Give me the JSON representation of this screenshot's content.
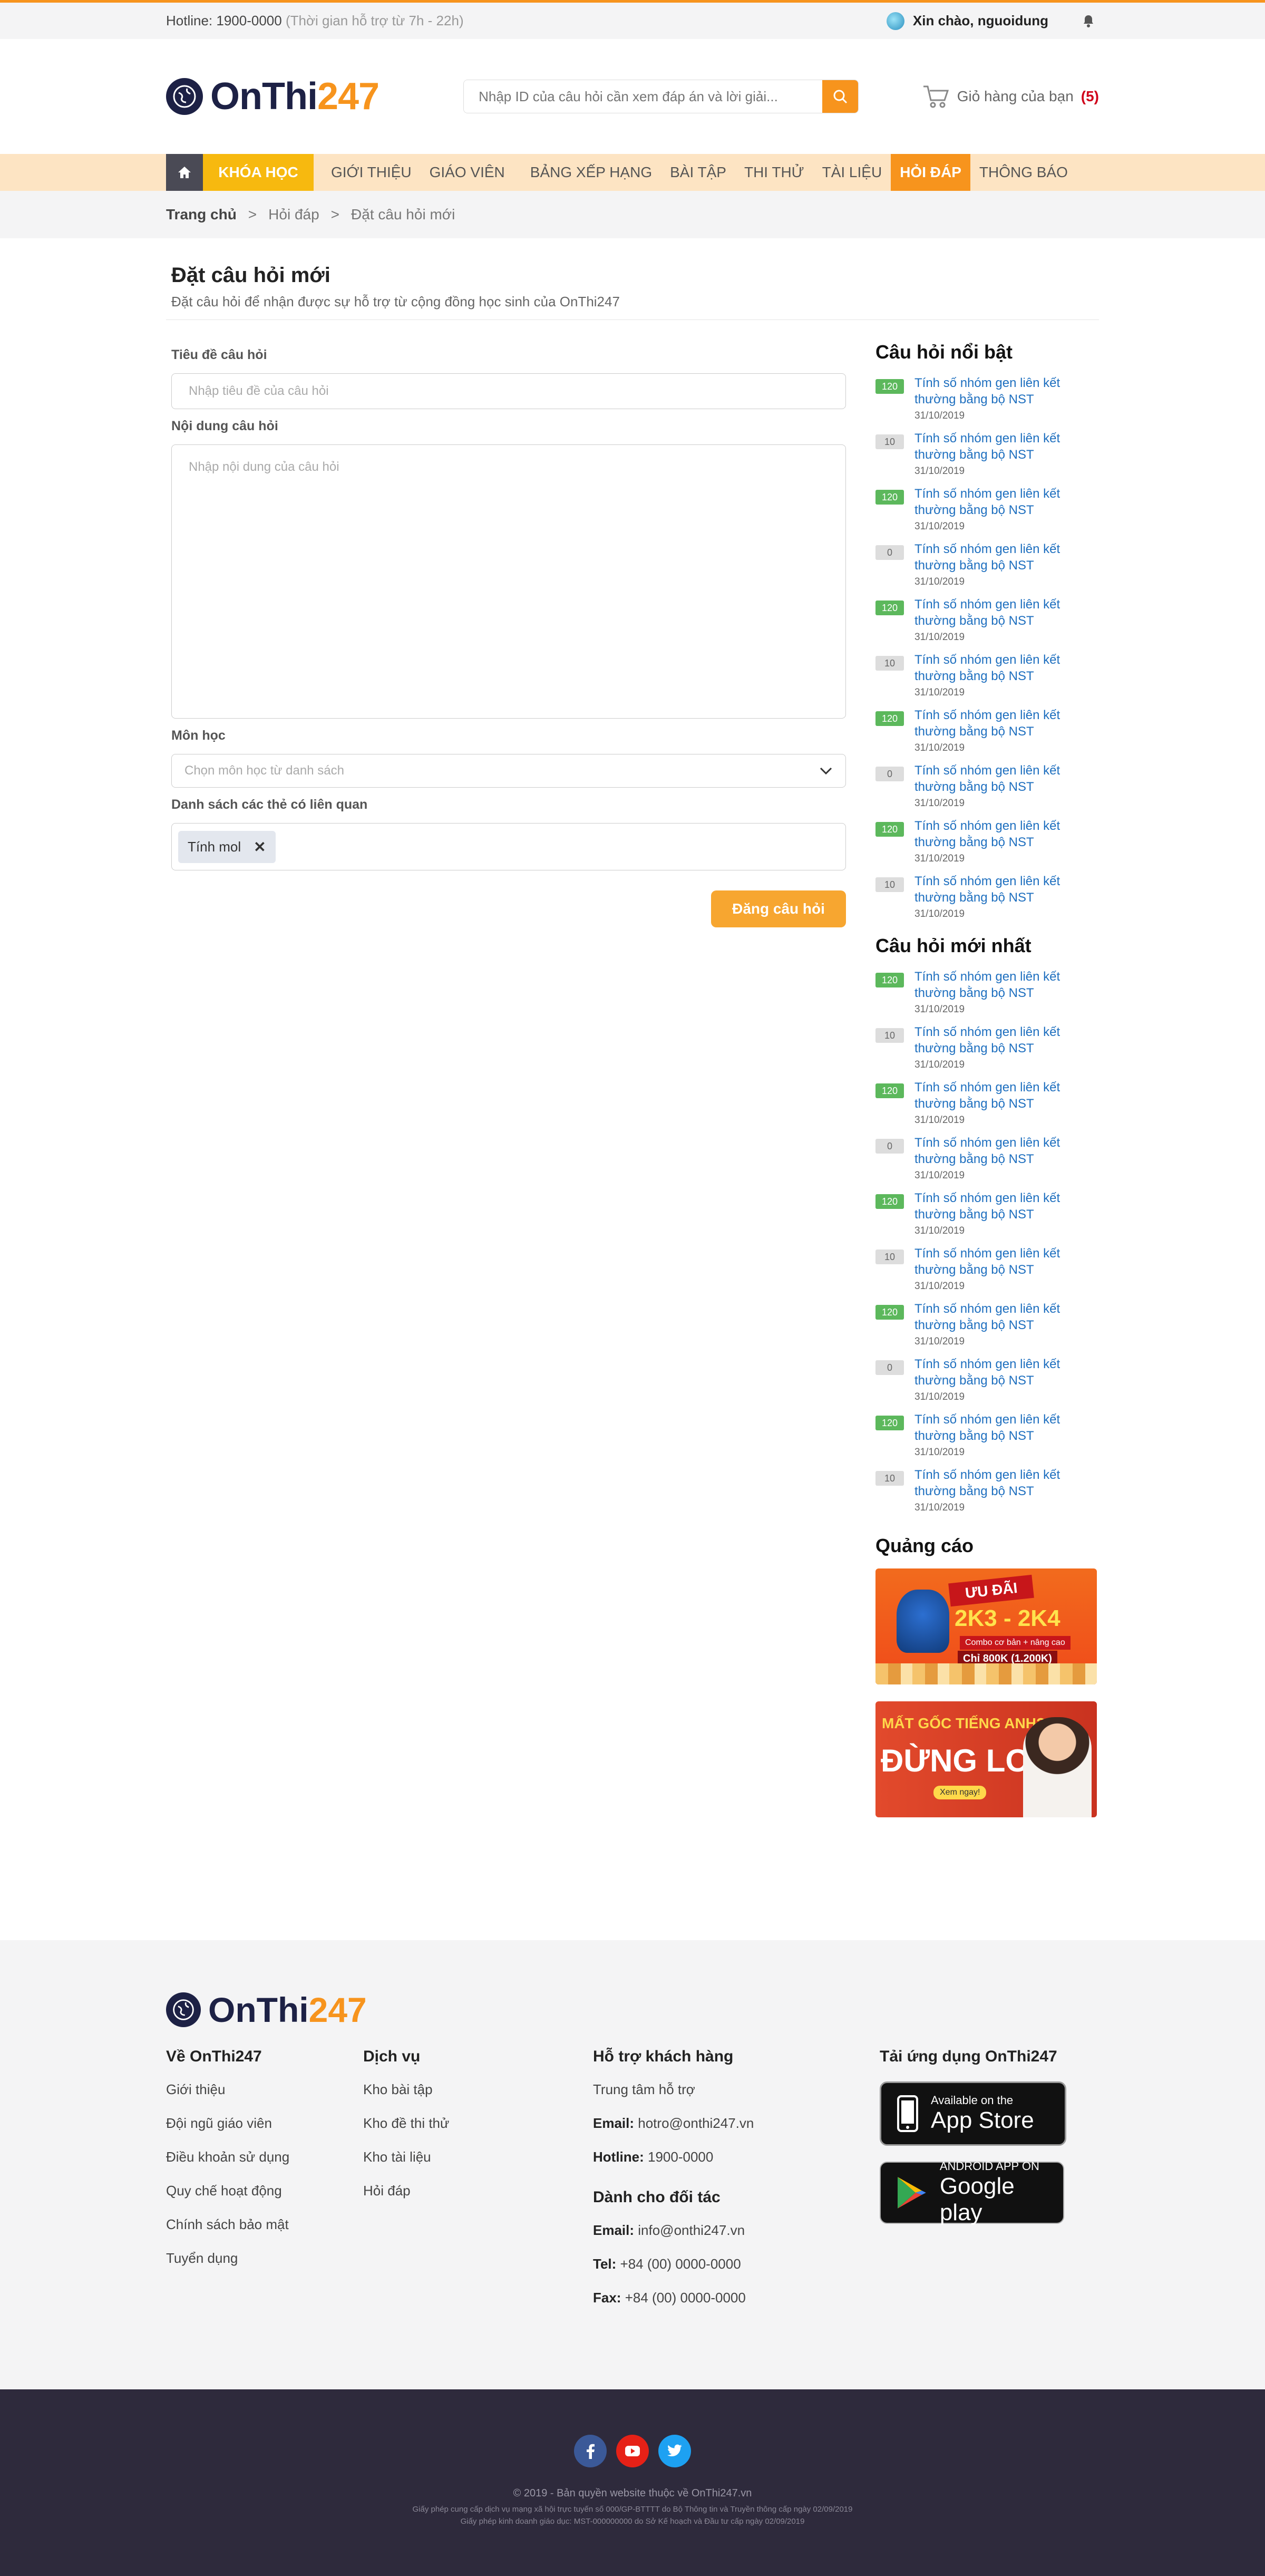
{
  "topbar": {
    "hotline": "Hotline: 1900-0000",
    "hotline_hours": "(Thời gian hỗ trợ từ 7h - 22h)",
    "greeting": "Xin chào, nguoidung"
  },
  "header": {
    "logo_main": "OnThi",
    "logo_accent": "247",
    "search_placeholder": "Nhập ID của câu hỏi cần xem đáp án và lời giải...",
    "cart_label": "Giỏ hàng của bạn",
    "cart_count": "(5)"
  },
  "nav": {
    "khoa_hoc": "KHÓA HỌC",
    "items": [
      "GIỚI THIỆU",
      "GIÁO VIÊN",
      "BẢNG XẾP HẠNG",
      "BÀI TẬP",
      "THI THỬ",
      "TÀI LIỆU",
      "HỎI ĐÁP",
      "THÔNG BÁO"
    ],
    "active_index": 6
  },
  "breadcrumb": [
    "Trang chủ",
    ">",
    "Hỏi đáp",
    ">",
    "Đặt câu hỏi mới"
  ],
  "page": {
    "title": "Đặt câu hỏi mới",
    "subtitle": "Đặt câu hỏi để nhận được sự hỗ trợ từ cộng đồng học sinh của OnThi247"
  },
  "form": {
    "title_label": "Tiêu đề câu hỏi",
    "title_placeholder": "Nhập tiêu đề của câu hỏi",
    "content_label": "Nội dung câu hỏi",
    "content_placeholder": "Nhập nội dung của câu hỏi",
    "subject_label": "Môn học",
    "subject_placeholder": "Chọn môn học từ danh sách",
    "tags_label": "Danh sách các thẻ có liên quan",
    "tag": "Tính mol",
    "tag_remove": "✕",
    "submit": "Đăng câu hỏi"
  },
  "sidebar": {
    "featured_title": "Câu hỏi nổi bật",
    "featured": [
      {
        "count": "120",
        "color": "green",
        "title": "Tính số nhóm gen liên kết thường bằng bộ NST",
        "date": "31/10/2019"
      },
      {
        "count": "10",
        "color": "gray",
        "title": "Tính số nhóm gen liên kết thường bằng bộ NST",
        "date": "31/10/2019"
      },
      {
        "count": "120",
        "color": "green",
        "title": "Tính số nhóm gen liên kết thường bằng bộ NST",
        "date": "31/10/2019"
      },
      {
        "count": "0",
        "color": "gray",
        "title": "Tính số nhóm gen liên kết thường bằng bộ NST",
        "date": "31/10/2019"
      },
      {
        "count": "120",
        "color": "green",
        "title": "Tính số nhóm gen liên kết thường bằng bộ NST",
        "date": "31/10/2019"
      },
      {
        "count": "10",
        "color": "gray",
        "title": "Tính số nhóm gen liên kết thường bằng bộ NST",
        "date": "31/10/2019"
      },
      {
        "count": "120",
        "color": "green",
        "title": "Tính số nhóm gen liên kết thường bằng bộ NST",
        "date": "31/10/2019"
      },
      {
        "count": "0",
        "color": "gray",
        "title": "Tính số nhóm gen liên kết thường bằng bộ NST",
        "date": "31/10/2019"
      },
      {
        "count": "120",
        "color": "green",
        "title": "Tính số nhóm gen liên kết thường bằng bộ NST",
        "date": "31/10/2019"
      },
      {
        "count": "10",
        "color": "gray",
        "title": "Tính số nhóm gen liên kết thường bằng bộ NST",
        "date": "31/10/2019"
      }
    ],
    "latest_title": "Câu hỏi mới nhất",
    "latest": [
      {
        "count": "120",
        "color": "green",
        "title": "Tính số nhóm gen liên kết thường bằng bộ NST",
        "date": "31/10/2019"
      },
      {
        "count": "10",
        "color": "gray",
        "title": "Tính số nhóm gen liên kết thường bằng bộ NST",
        "date": "31/10/2019"
      },
      {
        "count": "120",
        "color": "green",
        "title": "Tính số nhóm gen liên kết thường bằng bộ NST",
        "date": "31/10/2019"
      },
      {
        "count": "0",
        "color": "gray",
        "title": "Tính số nhóm gen liên kết thường bằng bộ NST",
        "date": "31/10/2019"
      },
      {
        "count": "120",
        "color": "green",
        "title": "Tính số nhóm gen liên kết thường bằng bộ NST",
        "date": "31/10/2019"
      },
      {
        "count": "10",
        "color": "gray",
        "title": "Tính số nhóm gen liên kết thường bằng bộ NST",
        "date": "31/10/2019"
      },
      {
        "count": "120",
        "color": "green",
        "title": "Tính số nhóm gen liên kết thường bằng bộ NST",
        "date": "31/10/2019"
      },
      {
        "count": "0",
        "color": "gray",
        "title": "Tính số nhóm gen liên kết thường bằng bộ NST",
        "date": "31/10/2019"
      },
      {
        "count": "120",
        "color": "green",
        "title": "Tính số nhóm gen liên kết thường bằng bộ NST",
        "date": "31/10/2019"
      },
      {
        "count": "10",
        "color": "gray",
        "title": "Tính số nhóm gen liên kết thường bằng bộ NST",
        "date": "31/10/2019"
      }
    ],
    "ads_title": "Quảng cáo",
    "ad1": {
      "ribbon": "ƯU ĐÃI",
      "headline": "2K3 - 2K4",
      "tagline": "Combo cơ bản + nâng cao",
      "price": "Chỉ 800K (1.200K)"
    },
    "ad2": {
      "line1": "MẤT GỐC TIẾNG ANH?",
      "line2": "ĐỪNG LO",
      "cta": "Xem ngay!"
    }
  },
  "footer": {
    "logo_main": "OnThi",
    "logo_accent": "247",
    "about_title": "Về OnThi247",
    "about_links": [
      "Giới thiệu",
      "Đội ngũ giáo viên",
      "Điều khoản sử dụng",
      "Quy chế hoạt động",
      "Chính sách bảo mật",
      "Tuyển dụng"
    ],
    "service_title": "Dịch vụ",
    "service_links": [
      "Kho bài tập",
      "Kho đề thi thử",
      "Kho tài liệu",
      "Hỏi đáp"
    ],
    "support_title": "Hỗ trợ khách hàng",
    "support_center": "Trung tâm hỗ trợ",
    "support_email_label": "Email:",
    "support_email": "hotro@onthi247.vn",
    "support_hotline_label": "Hotline:",
    "support_hotline": "1900-0000",
    "partner_title": "Dành cho đối tác",
    "partner_email_label": "Email:",
    "partner_email": "info@onthi247.vn",
    "partner_tel_label": "Tel:",
    "partner_tel": "+84 (00) 0000-0000",
    "partner_fax_label": "Fax:",
    "partner_fax": "+84 (00) 0000-0000",
    "app_title": "Tải ứng dụng OnThi247",
    "appstore_small": "Available on the",
    "appstore_big": "App Store",
    "gplay_small": "ANDROID APP ON",
    "gplay_big": "Google play"
  },
  "bottom": {
    "copyright": "© 2019 - Bản quyền website thuộc về OnThi247.vn",
    "license1": "Giấy phép cung cấp dịch vụ mạng xã hội trực tuyến số 000/GP-BTTTT do Bộ Thông tin và Truyền thông cấp ngày 02/09/2019",
    "license2": "Giấy phép kinh doanh giáo dục: MST-000000000 do Sở Kế hoạch và Đầu tư cấp ngày 02/09/2019"
  },
  "colors": {
    "accent": "#f7941d",
    "nav_bg": "#fde4c3",
    "khoa_hoc": "#f7b90f",
    "link_blue": "#1e6fbf",
    "badge_green": "#5cb85c",
    "navy": "#1d2145"
  }
}
